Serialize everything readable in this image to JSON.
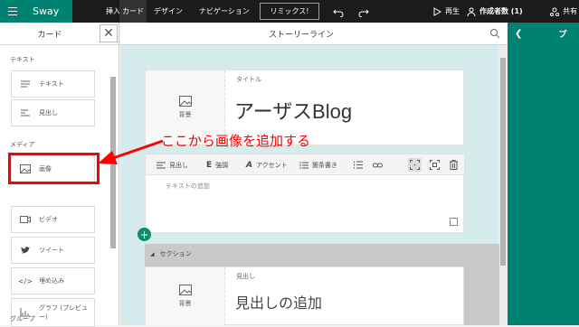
{
  "topbar": {
    "app_name": "Sway",
    "tabs": [
      {
        "label": "挿入"
      },
      {
        "label": "カード",
        "active": true
      },
      {
        "label": "デザイン"
      },
      {
        "label": "ナビゲーション"
      }
    ],
    "remix_label": "リミックス!",
    "play_label": "再生",
    "authors_label": "作成者数 (1)",
    "share_label": "共有",
    "brand_color": "#008272"
  },
  "sidebar": {
    "title": "カード",
    "sections": [
      {
        "label": "テキスト",
        "items": [
          {
            "label": "テキスト",
            "icon": "text-lines-icon"
          },
          {
            "label": "見出し",
            "icon": "heading-icon"
          }
        ]
      },
      {
        "label": "メディア",
        "items": [
          {
            "label": "画像",
            "icon": "image-icon"
          },
          {
            "label": "ビデオ",
            "icon": "video-icon"
          },
          {
            "label": "ツイート",
            "icon": "twitter-icon"
          },
          {
            "label": "埋め込み",
            "icon": "embed-code-icon"
          },
          {
            "label": "グラフ (プレビュー)",
            "icon": "chart-icon"
          }
        ]
      },
      {
        "label": "グループ",
        "items": []
      }
    ]
  },
  "main": {
    "title": "ストーリーライン",
    "title_card": {
      "label": "タイトル",
      "bg_label": "背景",
      "title_text": "アーザスBlog"
    },
    "toolbar": {
      "heading": "見出し",
      "emphasis": "強調",
      "accent": "アクセント",
      "bullets": "箇条書き"
    },
    "text_card": {
      "placeholder": "テキストの追加"
    },
    "section": {
      "label": "セクション",
      "heading_label": "見出し",
      "bg_label": "背景",
      "heading_placeholder": "見出しの追加"
    }
  },
  "annotation": {
    "text": "ここから画像を追加する",
    "color": "#ff0000"
  }
}
